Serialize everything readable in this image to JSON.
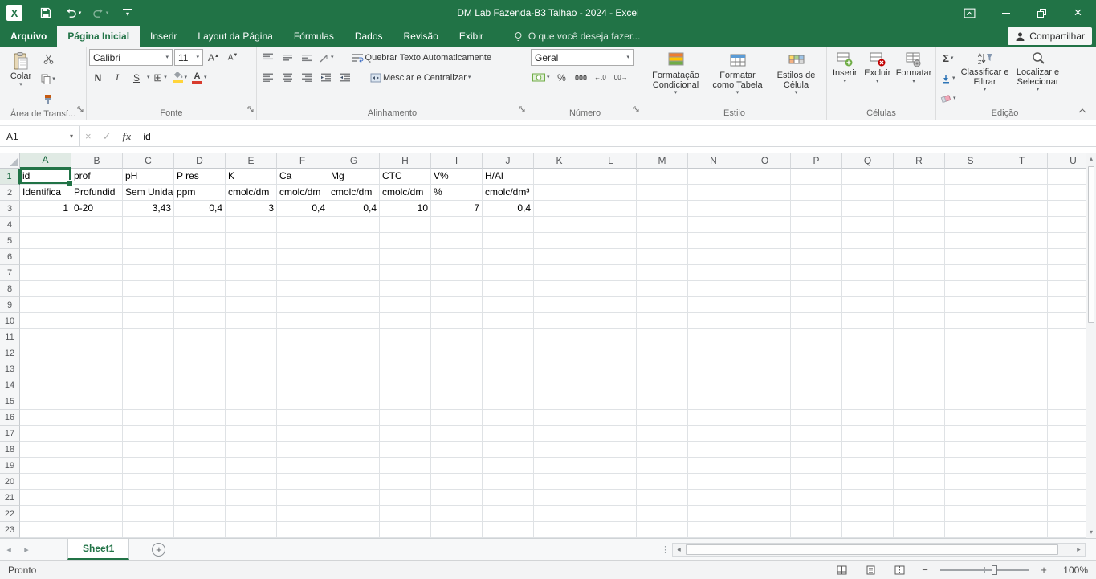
{
  "colors": {
    "accent": "#217346",
    "ribbon_bg": "#f3f4f5",
    "grid_line": "#dfe2e5",
    "selected_header_bg": "#e0eae4",
    "fill_color_bar": "#ffd43b",
    "font_color_bar": "#d83b2d"
  },
  "titlebar": {
    "title": "DM Lab Fazenda-B3 Talhao - 2024 - Excel"
  },
  "tabs": {
    "file": "Arquivo",
    "items": [
      "Página Inicial",
      "Inserir",
      "Layout da Página",
      "Fórmulas",
      "Dados",
      "Revisão",
      "Exibir"
    ],
    "active": "Página Inicial",
    "tell_me": "O que você deseja fazer...",
    "share": "Compartilhar"
  },
  "ribbon": {
    "clipboard": {
      "label": "Área de Transf...",
      "paste": "Colar"
    },
    "font": {
      "label": "Fonte",
      "name": "Calibri",
      "size": "11",
      "bold": "N",
      "italic": "I",
      "underline": "S"
    },
    "alignment": {
      "label": "Alinhamento",
      "wrap": "Quebrar Texto Automaticamente",
      "merge": "Mesclar e Centralizar"
    },
    "number": {
      "label": "Número",
      "format": "Geral",
      "percent": "%",
      "thousands": "000",
      "increase_decimal": "←.0",
      "decrease_decimal": ".00→"
    },
    "styles": {
      "label": "Estilo",
      "conditional": "Formatação Condicional",
      "as_table": "Formatar como Tabela",
      "cell_styles": "Estilos de Célula"
    },
    "cells": {
      "label": "Células",
      "insert": "Inserir",
      "delete": "Excluir",
      "format": "Formatar"
    },
    "editing": {
      "label": "Edição",
      "autosum": "Σ",
      "sort": "Classificar e Filtrar",
      "find": "Localizar e Selecionar"
    }
  },
  "formula_bar": {
    "name_box": "A1",
    "cancel": "×",
    "enter": "✓",
    "fx": "fx",
    "content": "id"
  },
  "grid": {
    "columns": [
      "A",
      "B",
      "C",
      "D",
      "E",
      "F",
      "G",
      "H",
      "I",
      "J",
      "K",
      "L",
      "M",
      "N",
      "O",
      "P",
      "Q",
      "R",
      "S",
      "T",
      "U"
    ],
    "row_count": 23,
    "selected_cell": "A1",
    "selected_col": "A",
    "selected_row": 1,
    "cells": [
      {
        "ref": "A1",
        "v": "id"
      },
      {
        "ref": "B1",
        "v": "prof"
      },
      {
        "ref": "C1",
        "v": "pH"
      },
      {
        "ref": "D1",
        "v": "P res"
      },
      {
        "ref": "E1",
        "v": "K"
      },
      {
        "ref": "F1",
        "v": "Ca"
      },
      {
        "ref": "G1",
        "v": "Mg"
      },
      {
        "ref": "H1",
        "v": "CTC"
      },
      {
        "ref": "I1",
        "v": "V%"
      },
      {
        "ref": "J1",
        "v": "H/Al"
      },
      {
        "ref": "A2",
        "v": "Identifica"
      },
      {
        "ref": "B2",
        "v": "Profundid"
      },
      {
        "ref": "C2",
        "v": "Sem Unida"
      },
      {
        "ref": "D2",
        "v": "ppm"
      },
      {
        "ref": "E2",
        "v": "cmolc/dm"
      },
      {
        "ref": "F2",
        "v": "cmolc/dm"
      },
      {
        "ref": "G2",
        "v": "cmolc/dm"
      },
      {
        "ref": "H2",
        "v": "cmolc/dm"
      },
      {
        "ref": "I2",
        "v": "%"
      },
      {
        "ref": "J2",
        "v": "cmolc/dm³"
      },
      {
        "ref": "A3",
        "v": "1",
        "align": "right"
      },
      {
        "ref": "B3",
        "v": "0-20"
      },
      {
        "ref": "C3",
        "v": "3,43",
        "align": "right"
      },
      {
        "ref": "D3",
        "v": "0,4",
        "align": "right"
      },
      {
        "ref": "E3",
        "v": "3",
        "align": "right"
      },
      {
        "ref": "F3",
        "v": "0,4",
        "align": "right"
      },
      {
        "ref": "G3",
        "v": "0,4",
        "align": "right"
      },
      {
        "ref": "H3",
        "v": "10",
        "align": "right"
      },
      {
        "ref": "I3",
        "v": "7",
        "align": "right"
      },
      {
        "ref": "J3",
        "v": "0,4",
        "align": "right"
      }
    ]
  },
  "sheet_bar": {
    "tabs": [
      "Sheet1"
    ],
    "active": "Sheet1"
  },
  "status_bar": {
    "mode": "Pronto",
    "zoom": "100%"
  },
  "icons": {
    "excel-app-icon": "white square, green X (css)",
    "save-icon": "floppy (svg)",
    "undo-icon": "curved-left-arrow (svg)",
    "redo-icon": "curved-right-arrow (svg, dimmed)",
    "qat-customize-icon": "▾ with overline (css)",
    "ribbon-display-options-icon": "box with chevron (svg)",
    "minimize-icon": "– (css line)",
    "restore-icon": "double squares (css)",
    "close-icon": "×",
    "lightbulb-icon": "bulb (svg)",
    "share-person-icon": "person silhouette (svg)",
    "paste-icon": "clipboard with page (svg)",
    "cut-icon": "scissors (svg)",
    "copy-icon": "two pages (svg)",
    "format-painter-icon": "brush (svg)",
    "font-grow-icon": "A▴",
    "font-shrink-icon": "A▾",
    "borders-icon": "⊞",
    "fill-color-icon": "bucket + yellow bar (svg+css)",
    "font-color-icon": "A + red bar (css)",
    "align-top-icon": "lines (svg)",
    "align-middle-icon": "lines (svg)",
    "align-bottom-icon": "lines (svg)",
    "orientation-icon": "diagonal arrow (svg)",
    "wrap-text-icon": "lines + return arrow (svg)",
    "merge-center-icon": "cell + inward arrows (svg)",
    "accounting-format-icon": "banknote + coin (svg)",
    "percent-icon": "%",
    "thousands-icon": "000",
    "increase-decimal-icon": "←.0",
    "decrease-decimal-icon": ".00→",
    "conditional-formatting-icon": "color-scale rows (svg)",
    "format-as-table-icon": "grid with blue header (svg)",
    "cell-styles-icon": "colored cells (svg)",
    "insert-cells-icon": "cells + green plus (svg)",
    "delete-cells-icon": "cells + red cross (svg)",
    "format-cells-icon": "cells + gear (svg)",
    "autosum-icon": "Σ",
    "fill-icon": "blue down arrow (svg)",
    "clear-icon": "eraser (svg)",
    "sort-filter-icon": "AZ arrow + funnel (svg)",
    "find-icon": "magnifier (svg)",
    "dialog-launcher-icon": "corner arrow (svg)",
    "collapse-ribbon-icon": "chevron up (svg)",
    "name-box-arrow-icon": "▾",
    "select-all-icon": "corner triangle (css)",
    "sheet-nav-left-icon": "◂",
    "sheet-nav-right-icon": "▸",
    "new-sheet-icon": "+ in circle (css)",
    "normal-view-icon": "grid (svg)",
    "page-layout-view-icon": "page (svg)",
    "page-break-view-icon": "page dashed (svg)",
    "zoom-out-icon": "−",
    "zoom-in-icon": "+",
    "scroll-up-icon": "▴",
    "scroll-down-icon": "▾",
    "scroll-left-icon": "◂",
    "scroll-right-icon": "▸"
  }
}
